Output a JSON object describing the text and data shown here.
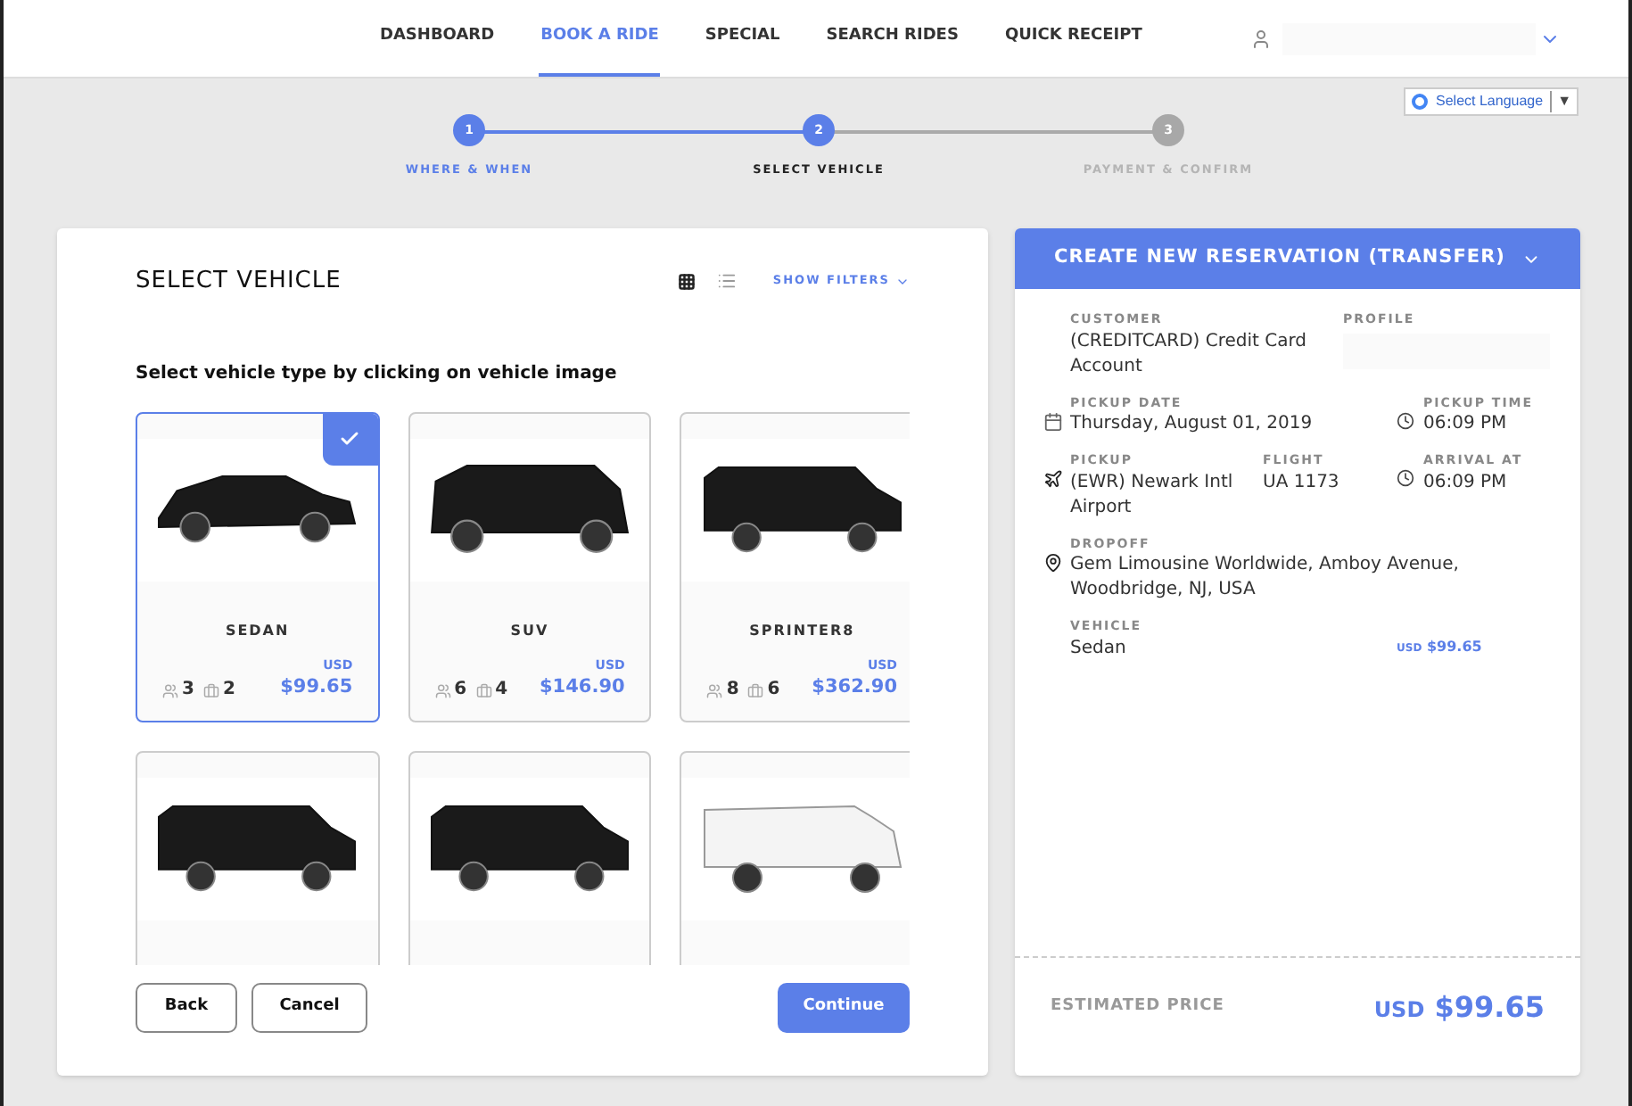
{
  "nav": {
    "items": [
      {
        "label": "DASHBOARD",
        "selected": false
      },
      {
        "label": "BOOK A RIDE",
        "selected": true
      },
      {
        "label": "SPECIAL",
        "selected": false
      },
      {
        "label": "SEARCH RIDES",
        "selected": false
      },
      {
        "label": "QUICK RECEIPT",
        "selected": false
      }
    ]
  },
  "language": {
    "label": "Select Language",
    "arrow": "▼"
  },
  "steps": [
    {
      "number": "1",
      "label": "WHERE & WHEN",
      "selected": false
    },
    {
      "number": "2",
      "label": "SELECT VEHICLE",
      "selected": true
    },
    {
      "number": "3",
      "label": "PAYMENT & CONFIRM",
      "selected": false
    }
  ],
  "vehicles_panel": {
    "title": "SELECT VEHICLE",
    "filters": "SHOW FILTERS",
    "view_options": [
      {
        "kind": "grid",
        "selected": true
      },
      {
        "kind": "list",
        "selected": false
      }
    ],
    "instruction": "Select vehicle type by clicking on vehicle image",
    "vehicles": [
      {
        "kind": "sedan",
        "name": "SEDAN",
        "passengers": "3",
        "bags": "2",
        "currency": "USD",
        "price": "$99.65",
        "selected": true
      },
      {
        "kind": "suv",
        "name": "SUV",
        "passengers": "6",
        "bags": "4",
        "currency": "USD",
        "price": "$146.90",
        "selected": false
      },
      {
        "kind": "van",
        "name": "SPRINTER8",
        "passengers": "8",
        "bags": "6",
        "currency": "USD",
        "price": "$362.90",
        "selected": false
      },
      {
        "kind": "van",
        "selected": false
      },
      {
        "kind": "van",
        "selected": false
      },
      {
        "kind": "bus",
        "selected": false
      }
    ],
    "buttons": {
      "back": "Back",
      "cancel": "Cancel",
      "continue": "Continue"
    }
  },
  "reservation": {
    "title": "CREATE NEW RESERVATION (TRANSFER)",
    "customer_label": "CUSTOMER",
    "customer": "(CREDITCARD) Credit Card Account",
    "profile_label": "PROFILE",
    "pickup_date_label": "PICKUP DATE",
    "pickup_date": "Thursday, August 01, 2019",
    "pickup_time_label": "PICKUP TIME",
    "pickup_time": "06:09 PM",
    "pickup_label": "PICKUP",
    "pickup": "(EWR) Newark Intl Airport",
    "flight_label": "FLIGHT",
    "flight": "UA 1173",
    "arrival_label": "ARRIVAL AT",
    "arrival": "06:09 PM",
    "dropoff_label": "DROPOFF",
    "dropoff": "Gem Limousine Worldwide, Amboy Avenue, Woodbridge, NJ, USA",
    "vehicle_label": "VEHICLE",
    "vehicle": "Sedan",
    "vehicle_currency": "USD",
    "vehicle_price": "$99.65",
    "estimate_label": "ESTIMATED PRICE",
    "estimate_currency": "USD",
    "estimate_price": "$99.65"
  }
}
